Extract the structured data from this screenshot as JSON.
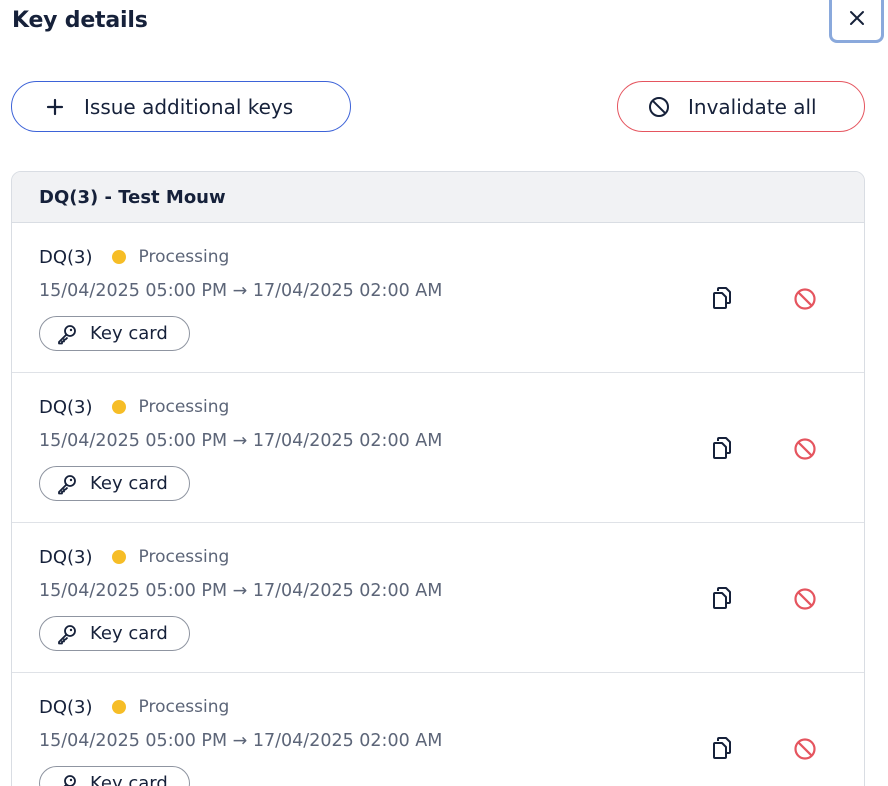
{
  "dialog": {
    "title": "Key details",
    "close_icon": "close-icon"
  },
  "actions": {
    "issue_label": "Issue additional keys",
    "issue_icon": "plus-icon",
    "invalidate_label": "Invalidate all",
    "invalidate_icon": "ban-icon"
  },
  "colors": {
    "accent_blue": "#3d63d8",
    "danger_red": "#e5555f",
    "status_processing": "#f6bd26",
    "text_primary": "#16213a",
    "text_secondary": "#5c6578"
  },
  "group": {
    "header": "DQ(3) - Test Mouw",
    "keys": [
      {
        "name": "DQ(3)",
        "status": "Processing",
        "date_range": "15/04/2025 05:00 PM → 17/04/2025 02:00 AM",
        "key_type": "Key card"
      },
      {
        "name": "DQ(3)",
        "status": "Processing",
        "date_range": "15/04/2025 05:00 PM → 17/04/2025 02:00 AM",
        "key_type": "Key card"
      },
      {
        "name": "DQ(3)",
        "status": "Processing",
        "date_range": "15/04/2025 05:00 PM → 17/04/2025 02:00 AM",
        "key_type": "Key card"
      },
      {
        "name": "DQ(3)",
        "status": "Processing",
        "date_range": "15/04/2025 05:00 PM → 17/04/2025 02:00 AM",
        "key_type": "Key card"
      }
    ]
  }
}
